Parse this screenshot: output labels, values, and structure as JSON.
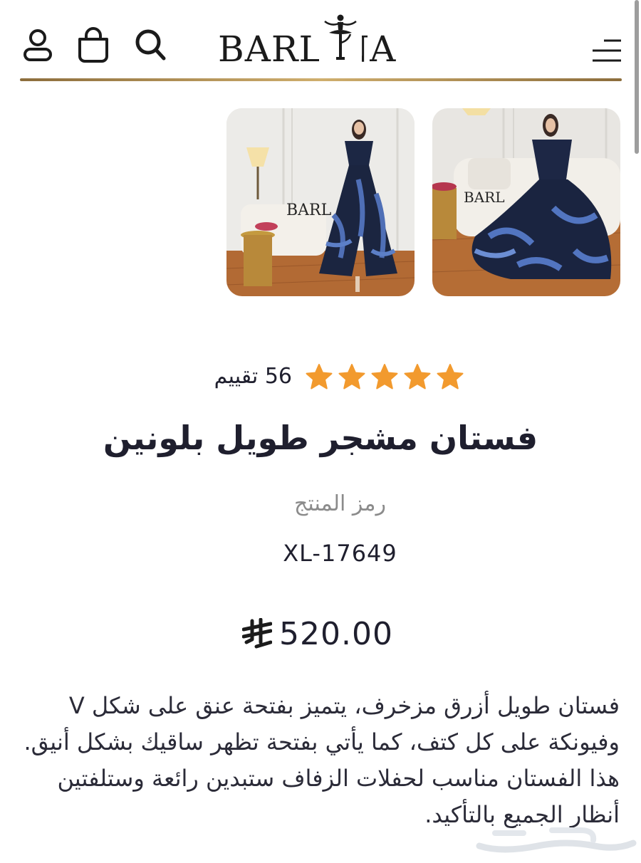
{
  "header": {
    "logo_text": "BARLINA",
    "icons": [
      "user-icon",
      "bag-icon",
      "search-icon",
      "menu-icon"
    ],
    "accent_line_color": "#b89455"
  },
  "gallery": {
    "images": [
      {
        "alt": "dress-photo-1",
        "watermark": "BARL"
      },
      {
        "alt": "dress-photo-2",
        "watermark": "BARL"
      }
    ]
  },
  "product": {
    "rating_stars": 5,
    "rating_color": "#f29a2e",
    "reviews": "56 تقييم",
    "title": "فستان مشجر طويل بلونين",
    "sku_label": "رمز المنتج",
    "sku": "XL-17649",
    "price": "520.00",
    "currency_icon": "saudi-riyal-icon",
    "description": "فستان طويل أزرق مزخرف، يتميز بفتحة عنق على شكل V وفيونكة على كل كتف، كما يأتي بفتحة تظهر ساقيك بشكل أنيق. هذا الفستان مناسب لحفلات الزفاف ستبدين رائعة وستلفتين أنظار الجميع بالتأكيد."
  }
}
